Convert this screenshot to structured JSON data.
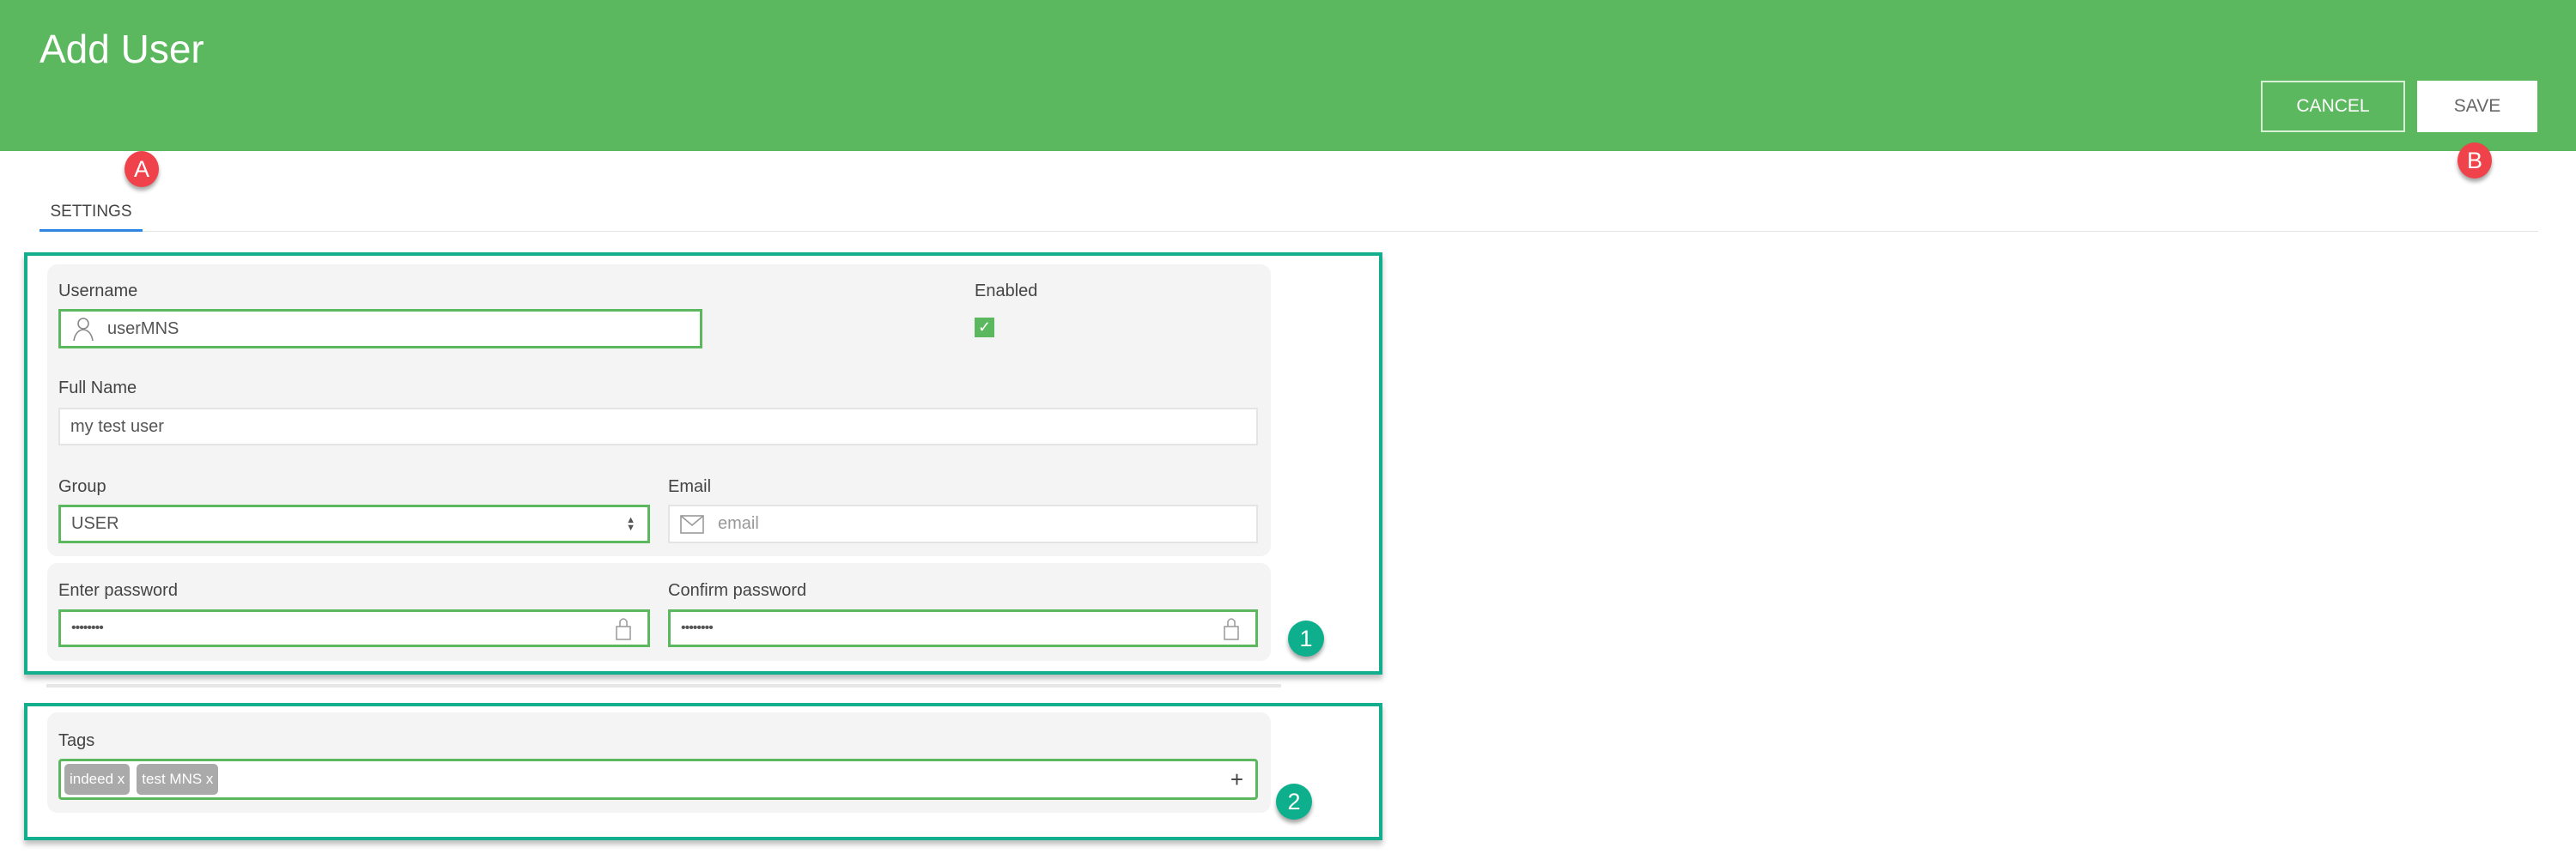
{
  "header": {
    "title": "Add User",
    "cancel_label": "CANCEL",
    "save_label": "SAVE",
    "bg_color": "#5cb85f"
  },
  "annotations": {
    "a": "A",
    "b": "B",
    "one": "1",
    "two": "2"
  },
  "tabs": [
    {
      "label": "SETTINGS",
      "active": true
    }
  ],
  "form": {
    "username_label": "Username",
    "username_value": "userMNS",
    "enabled_label": "Enabled",
    "enabled_checked": true,
    "fullname_label": "Full Name",
    "fullname_value": "my test user",
    "group_label": "Group",
    "group_value": "USER",
    "email_label": "Email",
    "email_placeholder": "email",
    "password_label": "Enter password",
    "password_value": "••••••••",
    "confirm_label": "Confirm password",
    "confirm_value": "••••••••",
    "tags_label": "Tags",
    "tags": [
      "indeed x",
      "test MNS x"
    ],
    "add_tag": "+"
  }
}
